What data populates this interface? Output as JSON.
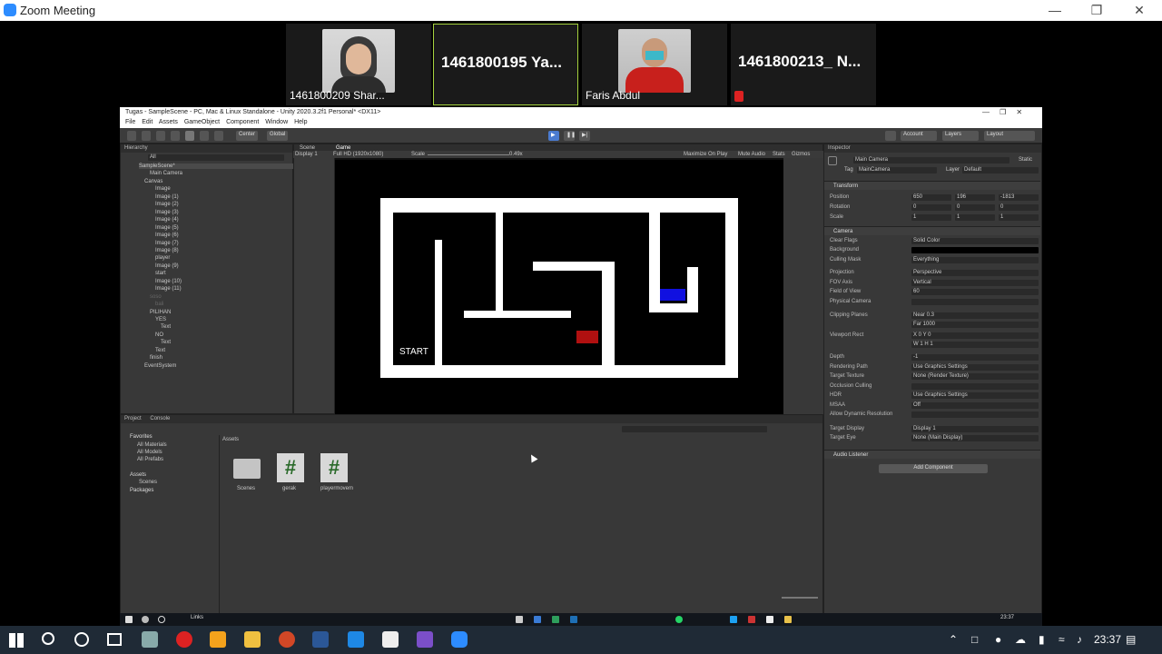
{
  "zoom": {
    "window_title": "Zoom Meeting",
    "participants": [
      {
        "label": "1461800209 Shar...",
        "type": "video"
      },
      {
        "label": "1461800195 Ya...",
        "type": "name",
        "active": true
      },
      {
        "label": "Faris Abdul",
        "type": "video"
      },
      {
        "label": "1461800213_ N...",
        "type": "name",
        "muted": true
      }
    ]
  },
  "unity": {
    "title": "Tugas - SampleScene - PC, Mac & Linux Standalone - Unity 2020.3.2f1 Personal* <DX11>",
    "menu": [
      "File",
      "Edit",
      "Assets",
      "GameObject",
      "Component",
      "Window",
      "Help"
    ],
    "toolbar": {
      "center": "Center",
      "global": "Global",
      "account": "Account",
      "layers": "Layers",
      "layout": "Layout"
    },
    "hierarchy": {
      "tab": "Hierarchy",
      "search_placeholder": "All",
      "items": [
        {
          "text": "SampleScene*",
          "indent": 0
        },
        {
          "text": "Main Camera",
          "indent": 2
        },
        {
          "text": "Canvas",
          "indent": 1
        },
        {
          "text": "Image",
          "indent": 3
        },
        {
          "text": "Image (1)",
          "indent": 3
        },
        {
          "text": "Image (2)",
          "indent": 3
        },
        {
          "text": "Image (3)",
          "indent": 3
        },
        {
          "text": "Image (4)",
          "indent": 3
        },
        {
          "text": "Image (5)",
          "indent": 3
        },
        {
          "text": "Image (6)",
          "indent": 3
        },
        {
          "text": "Image (7)",
          "indent": 3
        },
        {
          "text": "Image (8)",
          "indent": 3
        },
        {
          "text": "player",
          "indent": 3
        },
        {
          "text": "Image (9)",
          "indent": 3
        },
        {
          "text": "start",
          "indent": 3
        },
        {
          "text": "Image (10)",
          "indent": 3
        },
        {
          "text": "Image (11)",
          "indent": 3
        },
        {
          "text": "soso",
          "indent": 2,
          "dim": true
        },
        {
          "text": "bali",
          "indent": 3,
          "dim": true
        },
        {
          "text": "PILIHAN",
          "indent": 2
        },
        {
          "text": "YES",
          "indent": 3
        },
        {
          "text": "Text",
          "indent": 4
        },
        {
          "text": "NO",
          "indent": 3
        },
        {
          "text": "Text",
          "indent": 4
        },
        {
          "text": "Text",
          "indent": 3
        },
        {
          "text": "finish",
          "indent": 2
        },
        {
          "text": "EventSystem",
          "indent": 1
        }
      ]
    },
    "scene_tabs": {
      "scene": "Scene",
      "game": "Game"
    },
    "game_bar": {
      "display": "Display 1",
      "resolution": "Full HD (1920x1080)",
      "scale_label": "Scale",
      "scale_value": "0.49x",
      "maximize": "Maximize On Play",
      "mute": "Mute Audio",
      "stats": "Stats",
      "gizmos": "Gizmos"
    },
    "game_view": {
      "start_label": "START",
      "player_color": "#1010e0",
      "finish_color": "#b01010"
    },
    "project": {
      "tabs": [
        "Project",
        "Console"
      ],
      "favorites_label": "Favorites",
      "favorites": [
        "All Materials",
        "All Models",
        "All Prefabs"
      ],
      "assets_label": "Assets",
      "asset_children": [
        "Scenes"
      ],
      "packages_label": "Packages",
      "breadcrumb": "Assets",
      "files": [
        {
          "name": "Scenes",
          "icon": "folder-icon"
        },
        {
          "name": "gerak",
          "icon": "csharp-script-icon"
        },
        {
          "name": "playermovem",
          "icon": "csharp-script-icon"
        }
      ]
    },
    "inspector": {
      "tab": "Inspector",
      "object_name": "Main Camera",
      "static_label": "Static",
      "tag_label": "Tag",
      "tag_value": "MainCamera",
      "layer_label": "Layer",
      "layer_value": "Default",
      "transform_title": "Transform",
      "position": {
        "label": "Position",
        "x": "650",
        "y": "196",
        "z": "-1813"
      },
      "rotation": {
        "label": "Rotation",
        "x": "0",
        "y": "0",
        "z": "0"
      },
      "scale": {
        "label": "Scale",
        "x": "1",
        "y": "1",
        "z": "1"
      },
      "camera_title": "Camera",
      "camera_props": [
        {
          "label": "Clear Flags",
          "value": "Solid Color"
        },
        {
          "label": "Background",
          "value": ""
        },
        {
          "label": "Culling Mask",
          "value": "Everything"
        },
        {
          "label": "Projection",
          "value": "Perspective"
        },
        {
          "label": "FOV Axis",
          "value": "Vertical"
        },
        {
          "label": "Field of View",
          "value": "60"
        },
        {
          "label": "Physical Camera",
          "value": ""
        },
        {
          "label": "Clipping Planes",
          "value": "Near  0.3"
        },
        {
          "label": "",
          "value": "Far   1000"
        },
        {
          "label": "Viewport Rect",
          "value": "X 0     Y 0"
        },
        {
          "label": "",
          "value": "W 1     H 1"
        },
        {
          "label": "Depth",
          "value": "-1"
        },
        {
          "label": "Rendering Path",
          "value": "Use Graphics Settings"
        },
        {
          "label": "Target Texture",
          "value": "None (Render Texture)"
        },
        {
          "label": "Occlusion Culling",
          "value": ""
        },
        {
          "label": "HDR",
          "value": "Use Graphics Settings"
        },
        {
          "label": "MSAA",
          "value": "Off"
        },
        {
          "label": "Allow Dynamic Resolution",
          "value": ""
        },
        {
          "label": "Target Display",
          "value": "Display 1"
        },
        {
          "label": "Target Eye",
          "value": "None (Main Display)"
        }
      ],
      "audio_listener": "Audio Listener",
      "add_component": "Add Component"
    },
    "inner_taskbar": {
      "links": "Links",
      "time": "23:37"
    }
  },
  "taskbar": {
    "time": "23:37"
  }
}
